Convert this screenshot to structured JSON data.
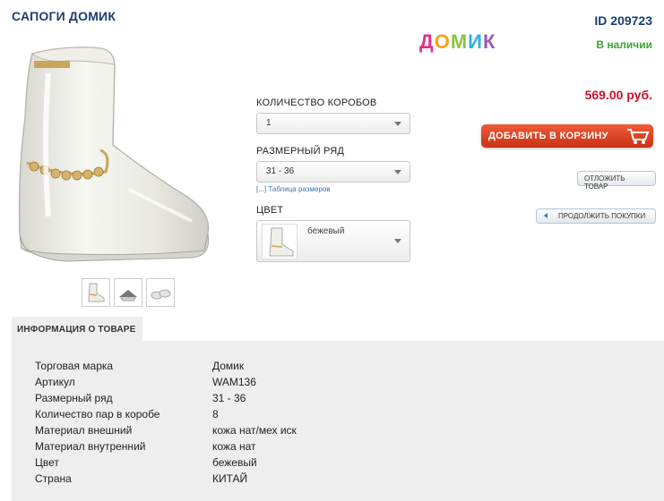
{
  "product": {
    "title": "САПОГИ ДОМИК",
    "id_label": "ID 209723",
    "availability": "В наличии",
    "price": "569.00 руб.",
    "brand_logo_letters": [
      "Д",
      "О",
      "М",
      "И",
      "К"
    ]
  },
  "options": {
    "boxes_label": "КОЛИЧЕСТВО КОРОБОВ",
    "boxes_value": "1",
    "size_label": "РАЗМЕРНЫЙ РЯД",
    "size_value": "31 - 36",
    "size_table_link": "[...] Таблица размеров",
    "color_label": "ЦВЕТ",
    "color_value": "бежевый"
  },
  "actions": {
    "add_to_cart": "ДОБАВИТЬ В КОРЗИНУ",
    "defer": "ОТЛОЖИТЬ ТОВАР",
    "continue": "ПРОДОЛЖИТЬ ПОКУПКИ"
  },
  "info": {
    "tab_label": "ИНФОРМАЦИЯ О ТОВАРЕ",
    "rows": [
      {
        "key": "Торговая марка",
        "value": "Домик"
      },
      {
        "key": "Артикул",
        "value": "WAM136"
      },
      {
        "key": "Размерный ряд",
        "value": "31 - 36"
      },
      {
        "key": "Количество пар в коробе",
        "value": "8"
      },
      {
        "key": "Материал внешний",
        "value": "кожа нат/мех иск"
      },
      {
        "key": "Материал внутренний",
        "value": "кожа нат"
      },
      {
        "key": "Цвет",
        "value": "бежевый"
      },
      {
        "key": "Страна",
        "value": "КИТАЙ"
      }
    ]
  },
  "colors": {
    "title": "#1a3f6e",
    "availability": "#3aa535",
    "price": "#c8102e",
    "cart_button": "#d9421f",
    "panel_bg": "#eeeeee"
  },
  "icons": {
    "cart": "cart-icon",
    "continue": "arrow-left-icon"
  }
}
